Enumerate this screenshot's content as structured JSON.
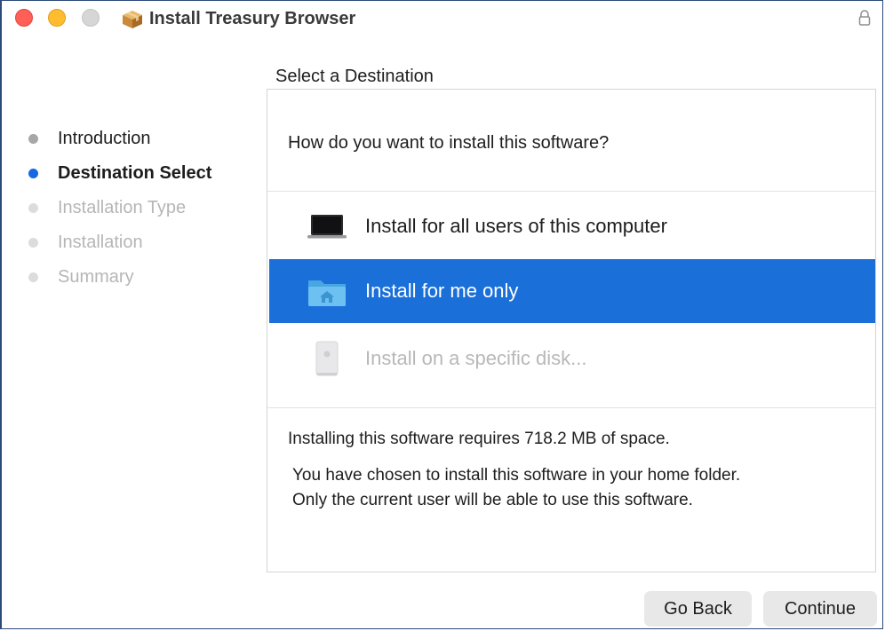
{
  "window": {
    "title": "Install Treasury Browser"
  },
  "sidebar": {
    "steps": [
      {
        "label": "Introduction",
        "state": "done"
      },
      {
        "label": "Destination Select",
        "state": "current"
      },
      {
        "label": "Installation Type",
        "state": "future"
      },
      {
        "label": "Installation",
        "state": "future"
      },
      {
        "label": "Summary",
        "state": "future"
      }
    ]
  },
  "main": {
    "heading": "Select a Destination",
    "question": "How do you want to install this software?",
    "options": [
      {
        "label": "Install for all users of this computer",
        "icon": "laptop-icon",
        "state": "normal"
      },
      {
        "label": "Install for me only",
        "icon": "home-folder-icon",
        "state": "selected"
      },
      {
        "label": "Install on a specific disk...",
        "icon": "disk-icon",
        "state": "disabled"
      }
    ],
    "space_required": "Installing this software requires 718.2 MB of space.",
    "explanation_line1": "You have chosen to install this software in your home folder.",
    "explanation_line2": "Only the current user will be able to use this software."
  },
  "buttons": {
    "back": "Go Back",
    "continue": "Continue"
  },
  "colors": {
    "accent": "#1a6fd9",
    "current_step_dot": "#1668e3"
  }
}
